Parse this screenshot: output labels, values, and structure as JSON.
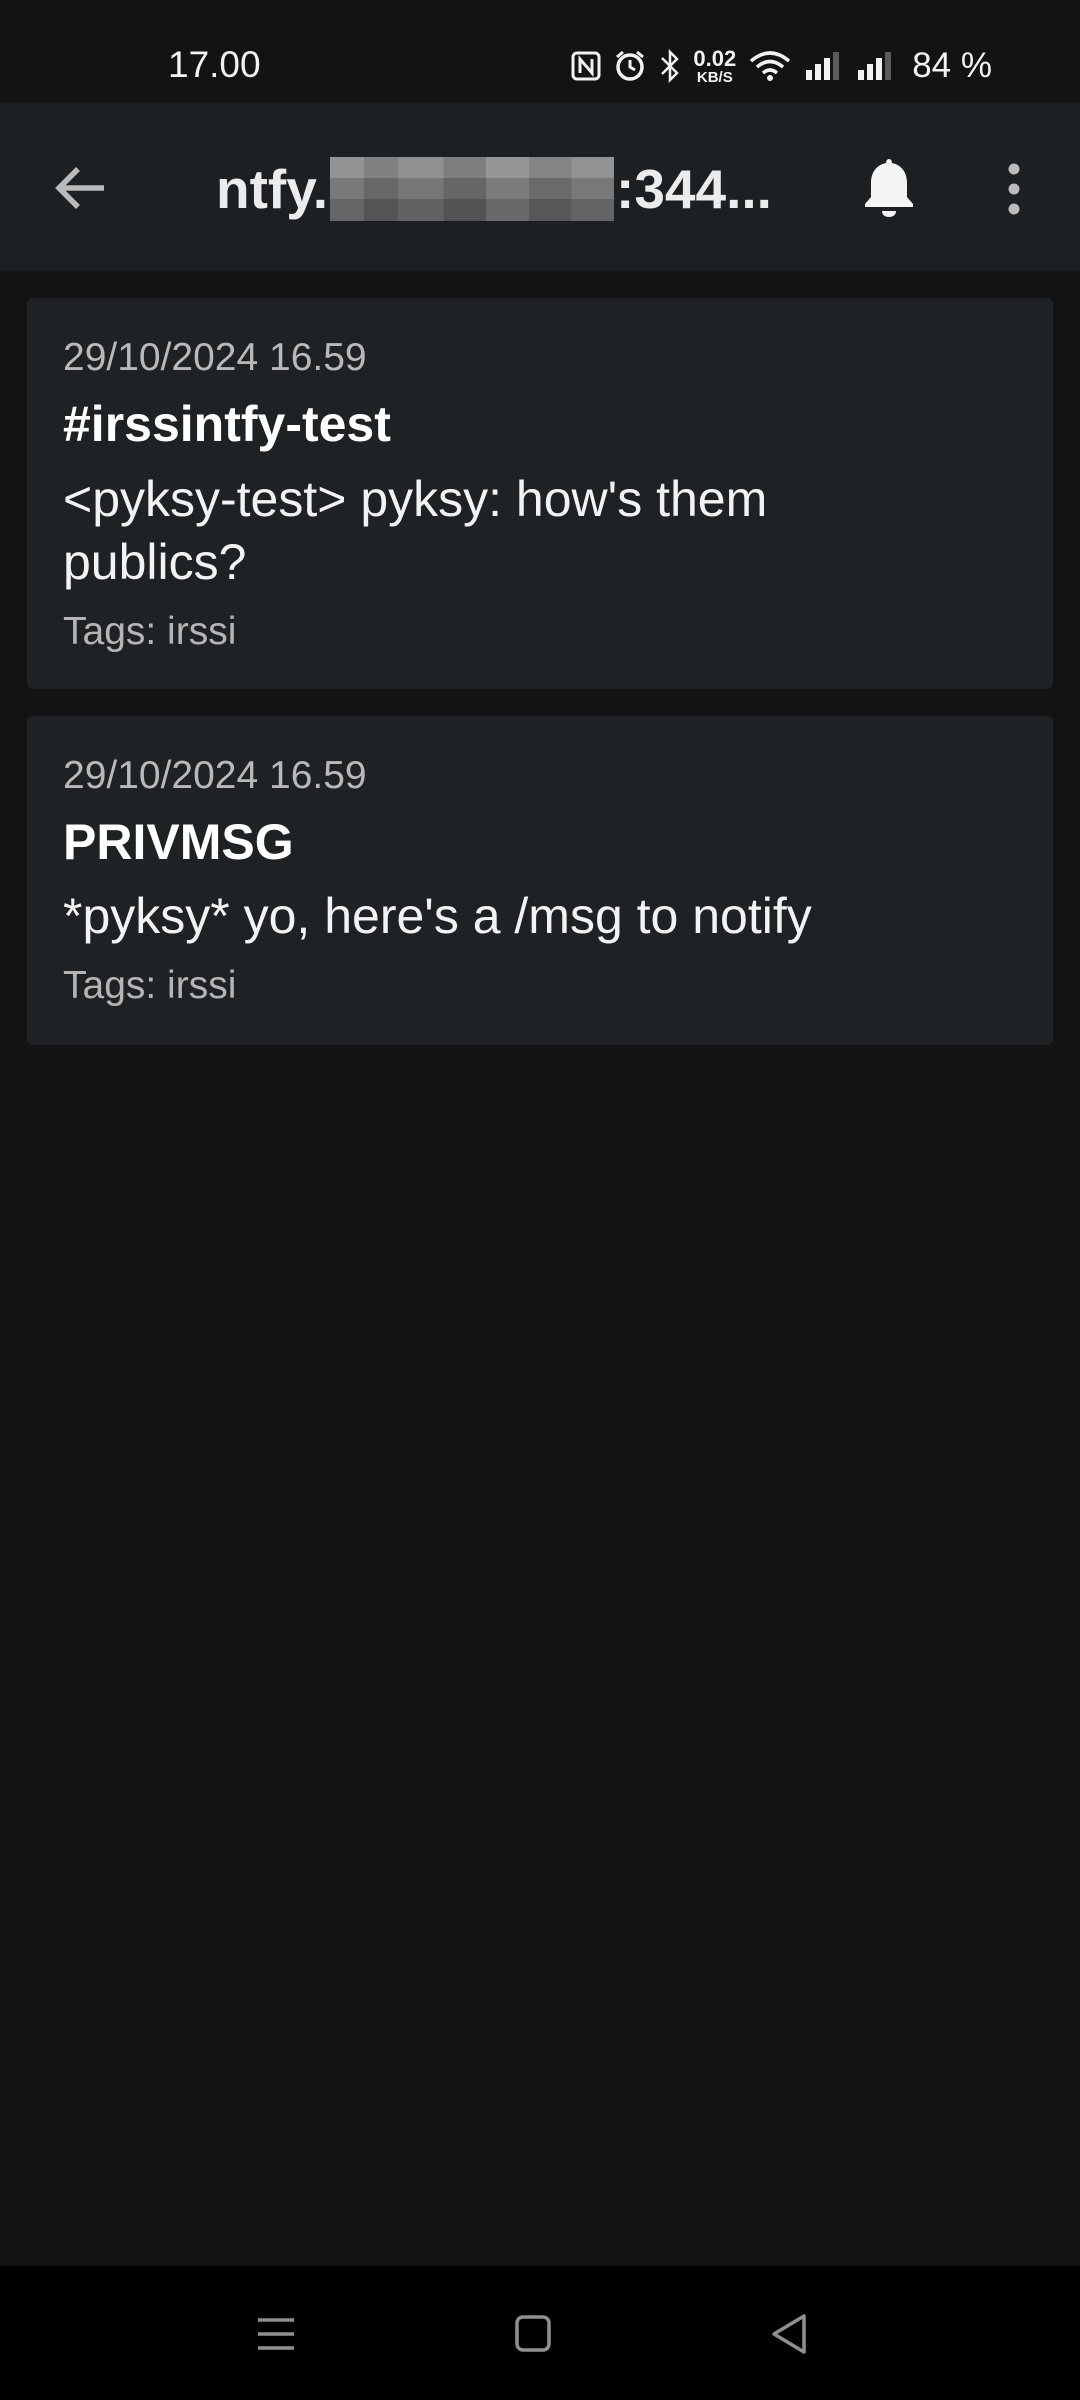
{
  "status_bar": {
    "time": "17.00",
    "icons": [
      "nfc-icon",
      "alarm-icon",
      "bluetooth-icon",
      "wifi-icon",
      "signal-icon",
      "signal-icon"
    ],
    "net_speed_value": "0.02",
    "net_speed_unit": "KB/S",
    "battery": "84 %"
  },
  "app_bar": {
    "title_prefix": "ntfy.",
    "title_suffix": ":344..."
  },
  "notifications": [
    {
      "date": "29/10/2024 16.59",
      "title": "#irssintfy-test",
      "message": "<pyksy-test> pyksy: how's them publics?",
      "tags": "Tags: irssi"
    },
    {
      "date": "29/10/2024 16.59",
      "title": "PRIVMSG",
      "message": "*pyksy* yo, here's a /msg to notify",
      "tags": "Tags: irssi"
    }
  ],
  "colors": {
    "background": "#131313",
    "app_bar": "#1d2022",
    "card": "#1f2224",
    "nav_bar": "#000000"
  }
}
